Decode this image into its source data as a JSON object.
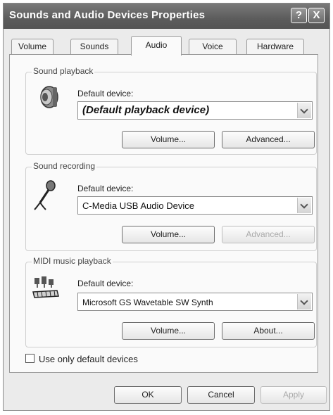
{
  "window": {
    "title": "Sounds and Audio Devices Properties",
    "help_label": "?",
    "close_label": "X"
  },
  "tabs": [
    {
      "label": "Volume"
    },
    {
      "label": "Sounds"
    },
    {
      "label": "Audio"
    },
    {
      "label": "Voice"
    },
    {
      "label": "Hardware"
    }
  ],
  "active_tab": "Audio",
  "sound_playback": {
    "legend": "Sound playback",
    "device_label": "Default device:",
    "device_value": "(Default playback device)",
    "volume_button": "Volume...",
    "advanced_button": "Advanced...",
    "icon": "speaker-icon"
  },
  "sound_recording": {
    "legend": "Sound recording",
    "device_label": "Default device:",
    "device_value": "C-Media USB Audio Device",
    "volume_button": "Volume...",
    "advanced_button": "Advanced...",
    "advanced_disabled": true,
    "icon": "microphone-icon"
  },
  "midi_playback": {
    "legend": "MIDI music playback",
    "device_label": "Default device:",
    "device_value": "Microsoft GS Wavetable SW Synth",
    "volume_button": "Volume...",
    "about_button": "About...",
    "icon": "midi-keyboard-icon"
  },
  "use_only_default": {
    "label": "Use only default devices",
    "checked": false
  },
  "footer": {
    "ok_label": "OK",
    "cancel_label": "Cancel",
    "apply_label": "Apply",
    "apply_disabled": true
  }
}
